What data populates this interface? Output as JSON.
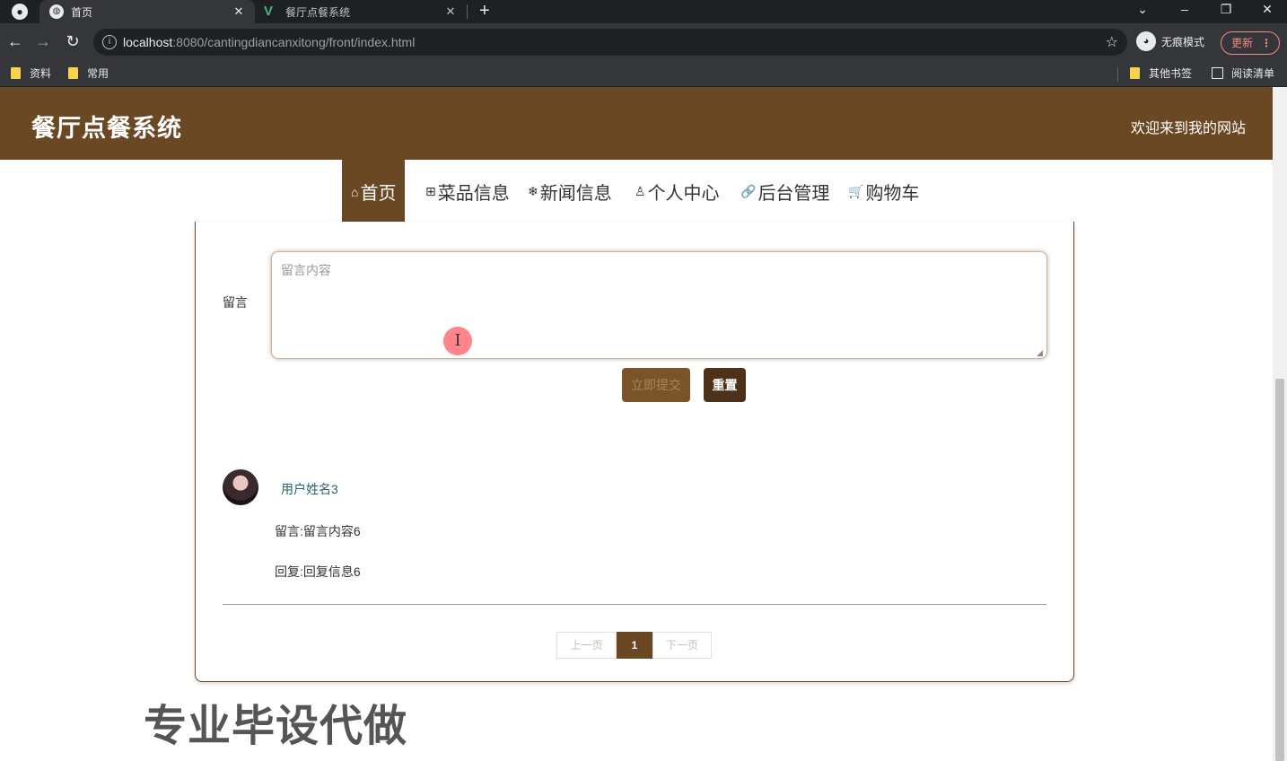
{
  "browser": {
    "tabs": [
      {
        "title": "首页",
        "active": true
      },
      {
        "title": "餐厅点餐系统",
        "active": false
      }
    ],
    "url_host": "localhost",
    "url_rest": ":8080/cantingdiancanxitong/front/index.html",
    "incognito_label": "无痕模式",
    "update_label": "更新",
    "bookmarks": [
      "资料",
      "常用"
    ],
    "other_bookmarks": "其他书签",
    "reading_list": "阅读清单"
  },
  "site": {
    "title": "餐厅点餐系统",
    "welcome": "欢迎来到我的网站"
  },
  "nav": [
    {
      "label": "首页",
      "icon": "home-icon",
      "glyph": "⌂",
      "active": true
    },
    {
      "label": "菜品信息",
      "icon": "gift-icon",
      "glyph": "⊞"
    },
    {
      "label": "新闻信息",
      "icon": "snowflake-icon",
      "glyph": "❄"
    },
    {
      "label": "个人中心",
      "icon": "user-icon",
      "glyph": "♙"
    },
    {
      "label": "后台管理",
      "icon": "link-icon",
      "glyph": "🔗"
    },
    {
      "label": "购物车",
      "icon": "cart-icon",
      "glyph": "🛒"
    }
  ],
  "form": {
    "label": "留言",
    "placeholder": "留言内容",
    "submit_label": "立即提交",
    "reset_label": "重置"
  },
  "messages": [
    {
      "username": "用户姓名3",
      "message": "留言:留言内容6",
      "reply": "回复:回复信息6"
    }
  ],
  "pagination": {
    "prev": "上一页",
    "current": "1",
    "next": "下一页"
  },
  "watermark": "专业毕设代做",
  "colors": {
    "brand": "#6b4824",
    "username": "#2b6170"
  }
}
